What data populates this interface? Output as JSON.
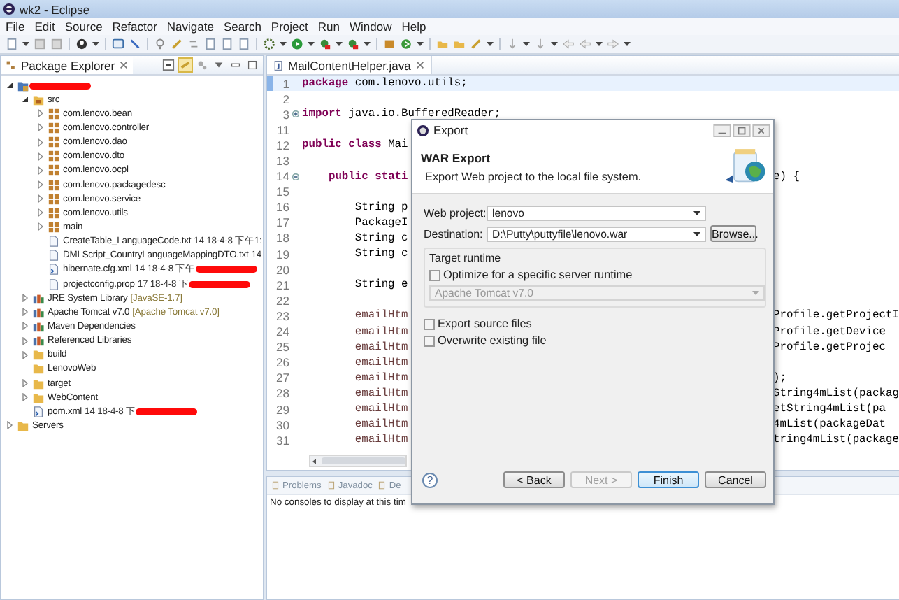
{
  "window": {
    "title": "wk2 - Eclipse"
  },
  "menu": [
    "File",
    "Edit",
    "Source",
    "Refactor",
    "Navigate",
    "Search",
    "Project",
    "Run",
    "Window",
    "Help"
  ],
  "package_explorer": {
    "title": "Package Explorer",
    "tree": [
      {
        "kind": "project",
        "redacted": true,
        "expanded": true,
        "children": [
          {
            "label": "src",
            "kind": "source-folder",
            "expanded": true,
            "children": [
              {
                "label": "com.lenovo.bean",
                "kind": "package",
                "expanded": false
              },
              {
                "label": "com.lenovo.controller",
                "kind": "package",
                "expanded": false
              },
              {
                "label": "com.lenovo.dao",
                "kind": "package",
                "expanded": false
              },
              {
                "label": "com.lenovo.dto",
                "kind": "package",
                "expanded": false
              },
              {
                "label": "com.lenovo.ocpl",
                "kind": "package",
                "expanded": false
              },
              {
                "label": "com.lenovo.packagedesc",
                "kind": "package",
                "expanded": false
              },
              {
                "label": "com.lenovo.service",
                "kind": "package",
                "expanded": false
              },
              {
                "label": "com.lenovo.utils",
                "kind": "package",
                "expanded": false
              },
              {
                "label": "main",
                "kind": "package",
                "expanded": false
              },
              {
                "label": "CreateTable_LanguageCode.txt",
                "detail": "14  18-4-8 下午1:",
                "kind": "file"
              },
              {
                "label": "DMLScript_CountryLanguageMappingDTO.txt",
                "detail": "14",
                "kind": "file"
              },
              {
                "label": "hibernate.cfg.xml",
                "detail": "14  18-4-8 下午",
                "kind": "xml",
                "redacted": true
              },
              {
                "label": "projectconfig.prop",
                "detail": "17  18-4-8 下",
                "kind": "file",
                "redacted": true
              }
            ]
          },
          {
            "label": "JRE System Library",
            "decoration": "[JavaSE-1.7]",
            "kind": "library",
            "expanded": false
          },
          {
            "label": "Apache Tomcat v7.0",
            "decoration": "[Apache Tomcat v7.0]",
            "kind": "library",
            "expanded": false
          },
          {
            "label": "Maven Dependencies",
            "kind": "library",
            "expanded": false
          },
          {
            "label": "Referenced Libraries",
            "kind": "library",
            "expanded": false
          },
          {
            "label": "build",
            "kind": "folder",
            "expanded": false
          },
          {
            "label": "LenovoWeb",
            "kind": "folder"
          },
          {
            "label": "target",
            "kind": "folder",
            "expanded": false
          },
          {
            "label": "WebContent",
            "kind": "folder",
            "expanded": false
          },
          {
            "label": "pom.xml",
            "detail": "14  18-4-8 下",
            "kind": "xml",
            "redacted": true
          }
        ]
      },
      {
        "label": "Servers",
        "kind": "folder",
        "expanded": false
      }
    ]
  },
  "editor": {
    "tab": "MailContentHelper.java",
    "lines": [
      {
        "number": "1",
        "current": true,
        "left": "**package** com.lenovo.utils;"
      },
      {
        "number": "2"
      },
      {
        "number": "3",
        "collapsed": true,
        "left": "**import** java.io.BufferedReader;"
      },
      {
        "number": "11"
      },
      {
        "number": "12",
        "left": "**public class** Mai"
      },
      {
        "number": "13"
      },
      {
        "number": "14",
        "collapsed": false,
        "left": "    **public stati**",
        "right": "e) {"
      },
      {
        "number": "15"
      },
      {
        "number": "16",
        "left": "        String p"
      },
      {
        "number": "17",
        "left": "        PackageI"
      },
      {
        "number": "18",
        "left": "        String c"
      },
      {
        "number": "19",
        "left": "        String c"
      },
      {
        "number": "20"
      },
      {
        "number": "21",
        "left": "        String e"
      },
      {
        "number": "22"
      },
      {
        "number": "23",
        "kind": "assignment",
        "left": "        emailHtm",
        "right": "Profile.getProjectI"
      },
      {
        "number": "24",
        "kind": "assignment",
        "left": "        emailHtm",
        "right": "Profile.getDevice"
      },
      {
        "number": "25",
        "kind": "assignment",
        "left": "        emailHtm",
        "right": "Profile.getProjec"
      },
      {
        "number": "26",
        "kind": "assignment",
        "left": "        emailHtm"
      },
      {
        "number": "27",
        "kind": "assignment",
        "left": "        emailHtm",
        "right": ");"
      },
      {
        "number": "28",
        "kind": "assignment",
        "left": "        emailHtm",
        "right": "String4mList(packag"
      },
      {
        "number": "29",
        "kind": "assignment",
        "left": "        emailHtm",
        "right": "etString4mList(pa"
      },
      {
        "number": "30",
        "kind": "assignment",
        "left": "        emailHtm",
        "right": "4mList(packageDat"
      },
      {
        "number": "31",
        "kind": "assignment",
        "left": "        emailHtm",
        "right": "tring4mList(package"
      }
    ]
  },
  "console": {
    "tabs": [
      {
        "label": "Problems",
        "selected": false
      },
      {
        "label": "Javadoc",
        "selected": false
      },
      {
        "label": "De",
        "selected": false
      }
    ],
    "message": "No consoles to display at this tim"
  },
  "dialog": {
    "title": "Export",
    "heading": "WAR Export",
    "description": "Export Web project to the local file system.",
    "fields": [
      {
        "label": "Web project:",
        "value": "lenovo"
      },
      {
        "label": "Destination:",
        "value": "D:\\Putty\\puttyfile\\lenovo.war",
        "button": "Browse..."
      }
    ],
    "group": {
      "title": "Target runtime",
      "option": {
        "label": "Optimize for a specific server runtime",
        "checked": false
      },
      "runtime": {
        "value": "Apache Tomcat v7.0",
        "disabled": true
      }
    },
    "options": [
      {
        "label": "Export source files",
        "checked": false
      },
      {
        "label": "Overwrite existing file",
        "checked": false
      }
    ],
    "help": "?",
    "buttons": [
      {
        "label": "< Back",
        "disabled": false,
        "default": false
      },
      {
        "label": "Next >",
        "disabled": true,
        "default": false
      },
      {
        "label": "Finish",
        "disabled": false,
        "default": true
      },
      {
        "label": "Cancel",
        "disabled": false,
        "default": false
      }
    ]
  }
}
